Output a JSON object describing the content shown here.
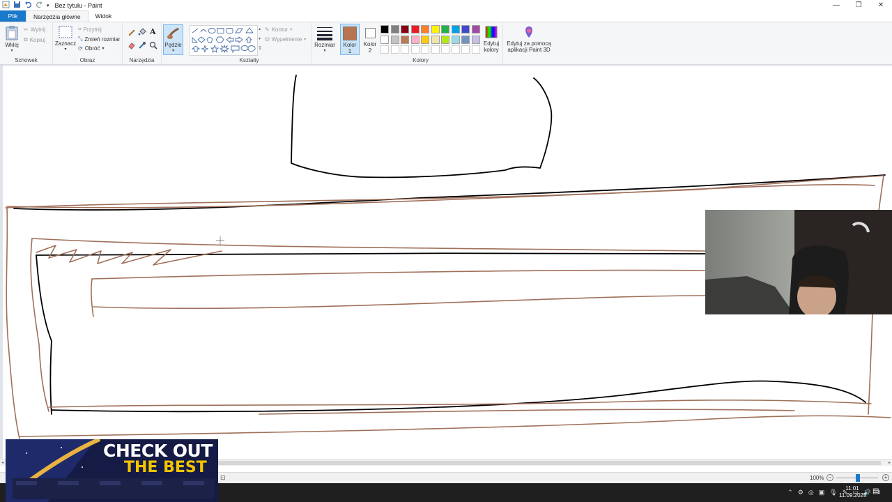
{
  "window": {
    "title": "Bez tytułu - Paint",
    "minimize_glyph": "—",
    "maximize_glyph": "❐",
    "close_glyph": "✕"
  },
  "menu": {
    "tabs": [
      "Plik",
      "Narzędzia główne",
      "Widok"
    ]
  },
  "ribbon": {
    "clipboard": {
      "label": "Schowek",
      "paste": "Wklej",
      "cut": "Wytnij",
      "copy": "Kopiuj"
    },
    "image": {
      "label": "Obraz",
      "select": "Zaznacz",
      "crop": "Przytnij",
      "resize": "Zmień rozmiar",
      "rotate": "Obróć"
    },
    "tools": {
      "label": "Narzędzia"
    },
    "brushes": {
      "label": "Pędzle"
    },
    "shapes": {
      "label": "Kształty",
      "outline": "Kontur",
      "fill": "Wypełnienie"
    },
    "size": {
      "label": "Rozmiar"
    },
    "colors": {
      "label": "Kolory",
      "color1": "Kolor 1",
      "color2": "Kolor 2",
      "edit_colors": "Edytuj kolory",
      "paint3d": "Edytuj za pomocą aplikacji Paint 3D",
      "color1_value": "#b87350",
      "color2_value": "#ffffff",
      "palette_row1": [
        "#000000",
        "#7f7f7f",
        "#880015",
        "#ed1c24",
        "#ff7f27",
        "#fff200",
        "#22b14c",
        "#00a2e8",
        "#3f48cc",
        "#a349a4"
      ],
      "palette_row2": [
        "#ffffff",
        "#c3c3c3",
        "#b97a57",
        "#ffaec9",
        "#ffc90e",
        "#efe4b0",
        "#b5e61d",
        "#99d9ea",
        "#7092be",
        "#c8bfe7"
      ]
    }
  },
  "canvas": {
    "stroke_brown": "#a0705a",
    "stroke_black": "#000000"
  },
  "statusbar": {
    "zoom": "100%",
    "zoom_minus": "−",
    "zoom_plus": "+"
  },
  "overlay": {
    "promo_line1": "CHECK OUT",
    "promo_line2": "THE BEST"
  },
  "taskbar": {
    "time": "11:01",
    "date": "11.09.2025",
    "notification_count": "3"
  }
}
